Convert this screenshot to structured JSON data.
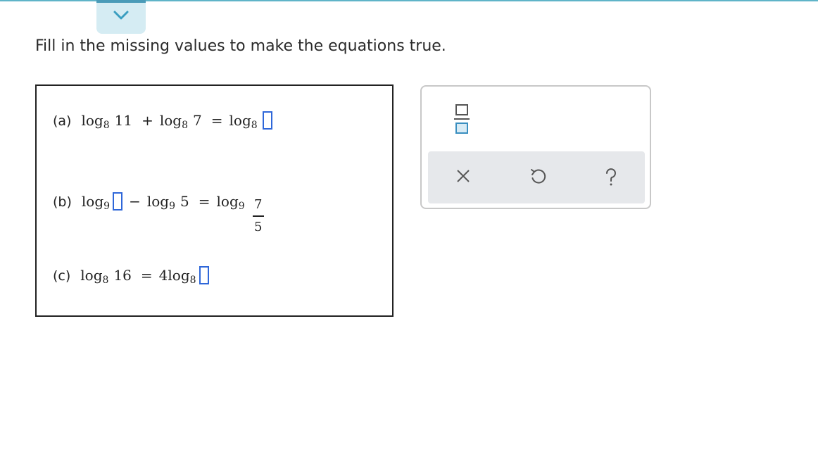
{
  "header": {
    "collapse_icon": "chevron-down-icon",
    "accent_color": "#5fb4c8"
  },
  "instruction": "Fill in the missing values to make the equations true.",
  "problems": {
    "a": {
      "label": "(a)",
      "log_word": "log",
      "base": "8",
      "term1": "11",
      "op1": "+",
      "term2": "7",
      "eq": "="
    },
    "b": {
      "label": "(b)",
      "log_word": "log",
      "base": "9",
      "op1": "−",
      "term2": "5",
      "eq": "=",
      "frac_num": "7",
      "frac_den": "5"
    },
    "c": {
      "label": "(c)",
      "log_word": "log",
      "base": "8",
      "term1": "16",
      "eq": "=",
      "coef": "4"
    }
  },
  "palette": {
    "fraction_tool_icon": "fraction-icon",
    "clear_icon": "x-icon",
    "undo_icon": "undo-icon",
    "help_icon": "question-icon",
    "answer_box_color": "#2f67d9"
  }
}
